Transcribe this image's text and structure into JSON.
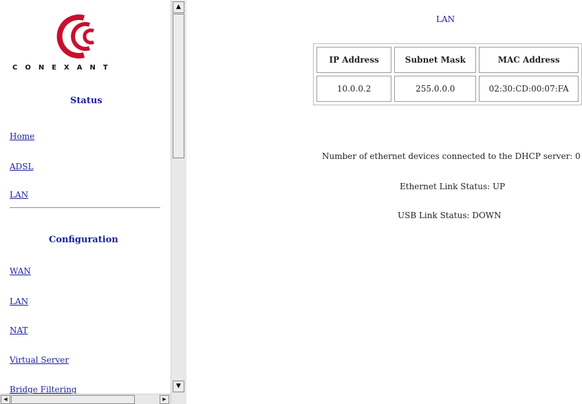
{
  "brand": {
    "logo_text": "CONEXANT"
  },
  "nav": {
    "status_heading": "Status",
    "status_links": [
      "Home",
      "ADSL",
      "LAN"
    ],
    "config_heading": "Configuration",
    "config_links": [
      "WAN",
      "LAN",
      "NAT",
      "Virtual Server",
      "Bridge Filtering"
    ]
  },
  "main": {
    "title": "LAN",
    "table": {
      "headers": [
        "IP Address",
        "Subnet Mask",
        "MAC Address"
      ],
      "row": [
        "10.0.0.2",
        "255.0.0.0",
        "02:30:CD:00:07:FA"
      ]
    },
    "dhcp_line": "Number of ethernet devices connected to the DHCP server: 0",
    "ethernet_status": "Ethernet Link Status: UP",
    "usb_status": "USB Link Status: DOWN"
  },
  "colors": {
    "link": "#1a1f9c",
    "logo_red": "#c8102e"
  }
}
